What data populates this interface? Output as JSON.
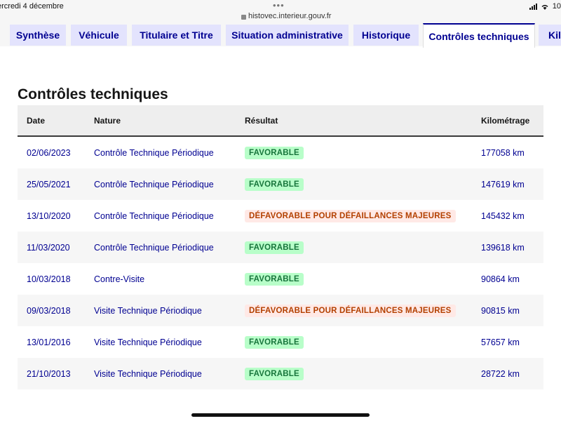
{
  "statusbar": {
    "date": "ercredi 4 décembre",
    "url": "histovec.interieur.gouv.fr",
    "battery": "10"
  },
  "tabs": [
    {
      "label": "Synthèse",
      "active": false
    },
    {
      "label": "Véhicule",
      "active": false
    },
    {
      "label": "Titulaire et Titre",
      "active": false
    },
    {
      "label": "Situation administrative",
      "active": false
    },
    {
      "label": "Historique",
      "active": false
    },
    {
      "label": "Contrôles techniques",
      "active": true
    },
    {
      "label": "Kilo",
      "active": false
    }
  ],
  "section": {
    "title": "Contrôles techniques"
  },
  "table": {
    "headers": {
      "date": "Date",
      "nature": "Nature",
      "result": "Résultat",
      "mileage": "Kilométrage"
    },
    "rows": [
      {
        "date": "02/06/2023",
        "nature": "Contrôle Technique Périodique",
        "result": "FAVORABLE",
        "status": "ok",
        "mileage": "177058 km"
      },
      {
        "date": "25/05/2021",
        "nature": "Contrôle Technique Périodique",
        "result": "FAVORABLE",
        "status": "ok",
        "mileage": "147619 km"
      },
      {
        "date": "13/10/2020",
        "nature": "Contrôle Technique Périodique",
        "result": "DÉFAVORABLE POUR DÉFAILLANCES MAJEURES",
        "status": "ko",
        "mileage": "145432 km"
      },
      {
        "date": "11/03/2020",
        "nature": "Contrôle Technique Périodique",
        "result": "FAVORABLE",
        "status": "ok",
        "mileage": "139618 km"
      },
      {
        "date": "10/03/2018",
        "nature": "Contre-Visite",
        "result": "FAVORABLE",
        "status": "ok",
        "mileage": "90864 km"
      },
      {
        "date": "09/03/2018",
        "nature": "Visite Technique Périodique",
        "result": "DÉFAVORABLE POUR DÉFAILLANCES MAJEURES",
        "status": "ko",
        "mileage": "90815 km"
      },
      {
        "date": "13/01/2016",
        "nature": "Visite Technique Périodique",
        "result": "FAVORABLE",
        "status": "ok",
        "mileage": "57657 km"
      },
      {
        "date": "21/10/2013",
        "nature": "Visite Technique Périodique",
        "result": "FAVORABLE",
        "status": "ok",
        "mileage": "28722 km"
      }
    ]
  },
  "colors": {
    "accent": "#000091",
    "favorable_bg": "#b8fec9",
    "favorable_fg": "#18753c",
    "defavorable_bg": "#ffe9e6",
    "defavorable_fg": "#b34000"
  }
}
